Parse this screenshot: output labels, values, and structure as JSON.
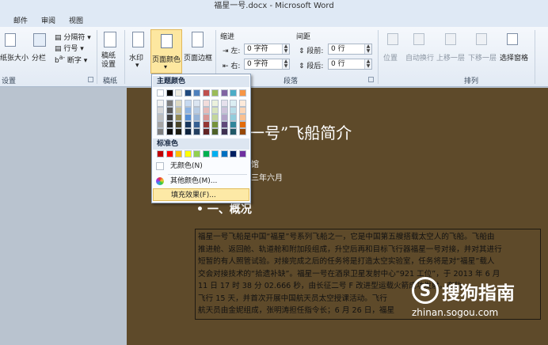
{
  "window": {
    "title": "福星一号.docx - Microsoft Word"
  },
  "tabs": [
    "邮件",
    "审阅",
    "视图"
  ],
  "ribbon": {
    "page_setup": {
      "paper_size": "纸张大小",
      "columns": "分栏",
      "breaks": "分隔符",
      "line_numbers": "行号",
      "hyphenation": "断字",
      "group_label": "设置"
    },
    "draft_paper": {
      "button": "稿纸\n设置",
      "group_label": "稿纸"
    },
    "page_background": {
      "watermark": "水印",
      "page_color": "页面颜色",
      "page_borders": "页面边框"
    },
    "paragraph": {
      "indent_header": "缩进",
      "spacing_header": "间距",
      "left_label": "左:",
      "left_value": "0 字符",
      "right_label": "右:",
      "right_value": "0 字符",
      "before_label": "段前:",
      "before_value": "0 行",
      "after_label": "段后:",
      "after_value": "0 行",
      "group_label": "段落"
    },
    "arrange": {
      "position": "位置",
      "wrap_text": "自动换行",
      "bring_forward": "上移一层",
      "send_backward": "下移一层",
      "selection_pane": "选择窗格",
      "group_label": "排列"
    }
  },
  "page_color_menu": {
    "theme_colors_label": "主题颜色",
    "theme_top_row": [
      "#ffffff",
      "#000000",
      "#eeece1",
      "#1f497d",
      "#4f81bd",
      "#c0504d",
      "#9bbb59",
      "#8064a2",
      "#4bacc6",
      "#f79646"
    ],
    "theme_shades": [
      [
        "#f2f2f2",
        "#7f7f7f",
        "#ddd9c3",
        "#c6d9f0",
        "#dbe5f1",
        "#f2dcdb",
        "#ebf1dd",
        "#e5e0ec",
        "#dbeef3",
        "#fdeada"
      ],
      [
        "#d8d8d8",
        "#595959",
        "#c4bd97",
        "#8db3e2",
        "#b8cce4",
        "#e5b9b7",
        "#d7e3bc",
        "#ccc1d9",
        "#b7dde8",
        "#fbd5b5"
      ],
      [
        "#bfbfbf",
        "#3f3f3f",
        "#938953",
        "#548dd4",
        "#95b3d7",
        "#d99694",
        "#c3d69b",
        "#b2a2c7",
        "#92cddc",
        "#fac08f"
      ],
      [
        "#a5a5a5",
        "#262626",
        "#494429",
        "#17365d",
        "#366092",
        "#953734",
        "#76923c",
        "#5f497a",
        "#31859b",
        "#e36c09"
      ],
      [
        "#7f7f7f",
        "#0c0c0c",
        "#1d1b10",
        "#0f243e",
        "#244061",
        "#632423",
        "#4f6128",
        "#3f3151",
        "#205867",
        "#974806"
      ]
    ],
    "standard_colors_label": "标准色",
    "standard_colors": [
      "#c00000",
      "#ff0000",
      "#ffc000",
      "#ffff00",
      "#92d050",
      "#00b050",
      "#00b0f0",
      "#0070c0",
      "#002060",
      "#7030a0"
    ],
    "no_color": "无颜色(N)",
    "more_colors": "其他颜色(M)...",
    "fill_effects": "填充效果(F)..."
  },
  "document": {
    "title_visible": "一号”飞船简介",
    "line1_tail": "馆",
    "line2_tail": "三年六月",
    "section_heading": "一、概况",
    "paragraph_lines": [
      "福星一号飞船是中国“福星”号系列飞船之一，它是中国第五艘搭载太空人的飞船。飞船由",
      "推进舱、返回舱、轨道舱和附加段组成，升空后再和目标飞行器福星一号对接，并对其进行",
      "短暂的有人照管试验。对接完成之后的任务将是打造太空实验室，任务将是对“福星”载人",
      "交会对接技术的“拾遗补缺”。福星一号在酒泉卫星发射中心“921 工位”，于 2013 年 6 月",
      "11 日 17 时 38 分 02.666 秒，由长征二号 F 改进型运载火箭成功发射。在轨",
      "飞行 15 天，并首次开展中国航天员太空授课活动。飞行",
      "航天员由金妮组成，张明涛担任指令长；6 月 26 日，福星"
    ]
  },
  "watermark": {
    "logo": "S",
    "brand": "搜狗指南",
    "url": "zhinan.sogou.com"
  }
}
